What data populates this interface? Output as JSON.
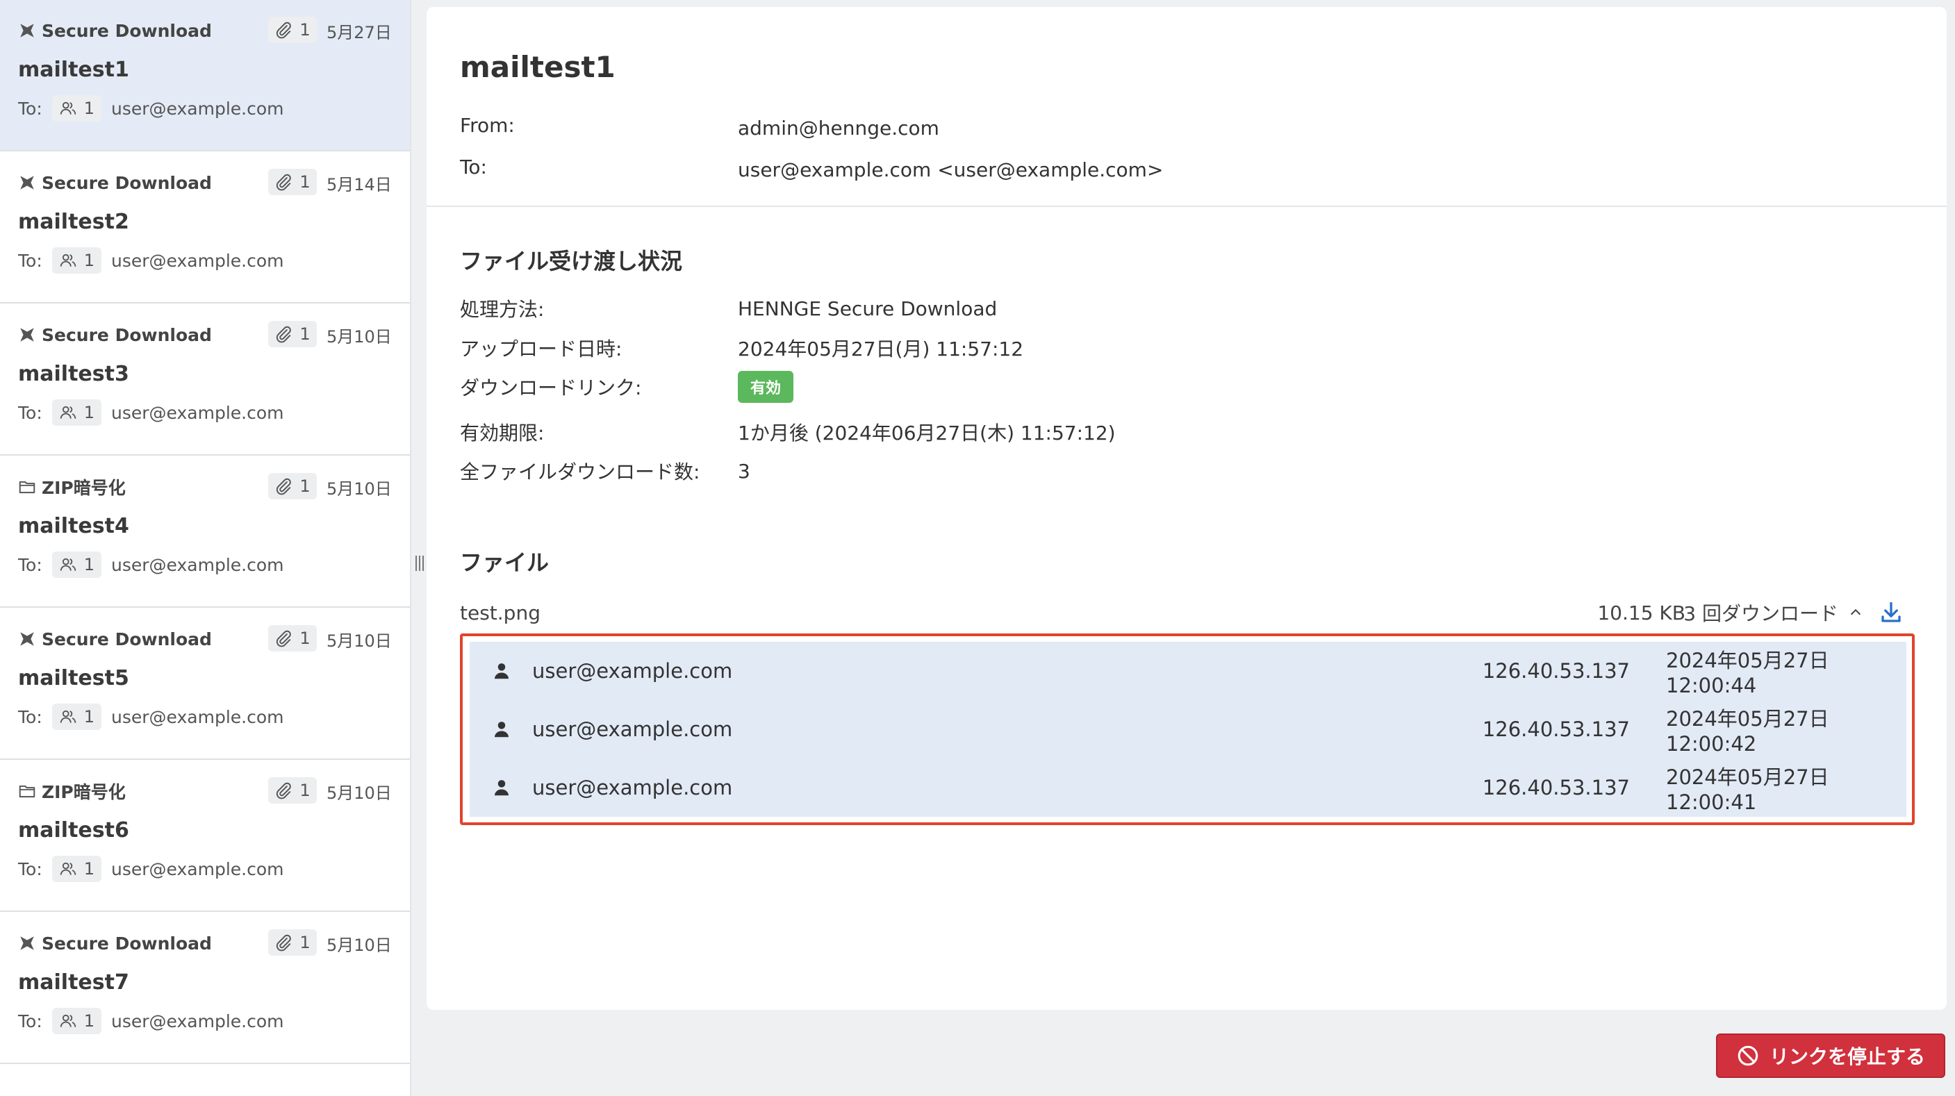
{
  "sidebar": {
    "to_prefix": "To:",
    "items": [
      {
        "type": "Secure Download",
        "type_icon": "secure-download-icon",
        "attachments": "1",
        "date": "5月27日",
        "subject": "mailtest1",
        "recipient_count": "1",
        "recipient": "user@example.com",
        "selected": true
      },
      {
        "type": "Secure Download",
        "type_icon": "secure-download-icon",
        "attachments": "1",
        "date": "5月14日",
        "subject": "mailtest2",
        "recipient_count": "1",
        "recipient": "user@example.com",
        "selected": false
      },
      {
        "type": "Secure Download",
        "type_icon": "secure-download-icon",
        "attachments": "1",
        "date": "5月10日",
        "subject": "mailtest3",
        "recipient_count": "1",
        "recipient": "user@example.com",
        "selected": false
      },
      {
        "type": "ZIP暗号化",
        "type_icon": "folder-icon",
        "attachments": "1",
        "date": "5月10日",
        "subject": "mailtest4",
        "recipient_count": "1",
        "recipient": "user@example.com",
        "selected": false
      },
      {
        "type": "Secure Download",
        "type_icon": "secure-download-icon",
        "attachments": "1",
        "date": "5月10日",
        "subject": "mailtest5",
        "recipient_count": "1",
        "recipient": "user@example.com",
        "selected": false
      },
      {
        "type": "ZIP暗号化",
        "type_icon": "folder-icon",
        "attachments": "1",
        "date": "5月10日",
        "subject": "mailtest6",
        "recipient_count": "1",
        "recipient": "user@example.com",
        "selected": false
      },
      {
        "type": "Secure Download",
        "type_icon": "secure-download-icon",
        "attachments": "1",
        "date": "5月10日",
        "subject": "mailtest7",
        "recipient_count": "1",
        "recipient": "user@example.com",
        "selected": false
      }
    ]
  },
  "detail": {
    "subject": "mailtest1",
    "from_label": "From:",
    "from_value": "admin@hennge.com",
    "to_label": "To:",
    "to_value": "user@example.com <user@example.com>"
  },
  "status": {
    "title": "ファイル受け渡し状況",
    "method_label": "処理方法:",
    "method_value": "HENNGE Secure Download",
    "upload_label": "アップロード日時:",
    "upload_value": "2024年05月27日(月) 11:57:12",
    "link_label": "ダウンロードリンク:",
    "link_badge": "有効",
    "expiry_label": "有効期限:",
    "expiry_value": "1か月後 (2024年06月27日(木) 11:57:12)",
    "total_label": "全ファイルダウンロード数:",
    "total_value": "3"
  },
  "files": {
    "title": "ファイル",
    "items": [
      {
        "name": "test.png",
        "size": "10.15 KB",
        "downloads": "3 回ダウンロード",
        "log": [
          {
            "email": "user@example.com",
            "ip": "126.40.53.137",
            "time": "2024年05月27日 12:00:44"
          },
          {
            "email": "user@example.com",
            "ip": "126.40.53.137",
            "time": "2024年05月27日 12:00:42"
          },
          {
            "email": "user@example.com",
            "ip": "126.40.53.137",
            "time": "2024年05月27日 12:00:41"
          }
        ]
      }
    ]
  },
  "actions": {
    "stop_link": "リンクを停止する"
  },
  "colors": {
    "selected_bg": "#e4ebf6",
    "badge_green": "#5cb85c",
    "danger_red": "#d0313c",
    "highlight_border": "#e0442c",
    "link_blue": "#2a6fc9"
  }
}
